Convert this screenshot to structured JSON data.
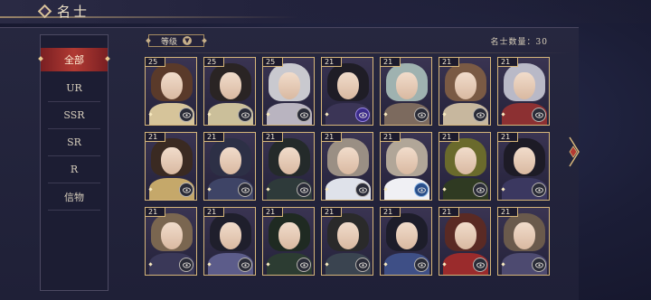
{
  "header": {
    "title": "名士"
  },
  "sidebar": {
    "items": [
      {
        "label": "全部",
        "active": true
      },
      {
        "label": "UR"
      },
      {
        "label": "SSR"
      },
      {
        "label": "SR"
      },
      {
        "label": "R"
      },
      {
        "label": "信物"
      }
    ]
  },
  "toolbar": {
    "sort_label": "等级",
    "count_text": "名士数量：30"
  },
  "cards": [
    {
      "level": "25",
      "badge": "eye-gray",
      "hair": "#5a3a2a",
      "robe": "#d6c49a"
    },
    {
      "level": "25",
      "badge": "eye-gray",
      "hair": "#2a2424",
      "robe": "#cbbf9a"
    },
    {
      "level": "25",
      "badge": "eye-gray",
      "hair": "#c9c9cf",
      "robe": "#b9b4c0"
    },
    {
      "level": "21",
      "badge": "eye-purple",
      "hair": "#1f1d26",
      "robe": "#3b3556"
    },
    {
      "level": "21",
      "badge": "eye-gray",
      "hair": "#9fb2b0",
      "robe": "#7c6a5e"
    },
    {
      "level": "21",
      "badge": "eye-gray",
      "hair": "#7a5a44",
      "robe": "#c7b79e"
    },
    {
      "level": "21",
      "badge": "eye-gray",
      "hair": "#b9b9c7",
      "robe": "#8c3032"
    },
    {
      "level": "21",
      "badge": "eye-gray",
      "hair": "#3a2a22",
      "robe": "#c5a86a"
    },
    {
      "level": "21",
      "badge": "eye-gray",
      "hair": "#2d3046",
      "robe": "#3e4466"
    },
    {
      "level": "21",
      "badge": "eye-gray",
      "hair": "#242a2a",
      "robe": "#2e3a3a"
    },
    {
      "level": "21",
      "badge": "eye-gray",
      "hair": "#9a8f84",
      "robe": "#dfe2ea"
    },
    {
      "level": "21",
      "badge": "eye-blue",
      "hair": "#b1a698",
      "robe": "#f0f0f4"
    },
    {
      "level": "21",
      "badge": "eye-gray",
      "hair": "#6a6a2c",
      "robe": "#2f3a22"
    },
    {
      "level": "21",
      "badge": "eye-gray",
      "hair": "#1d1b26",
      "robe": "#3b3860"
    },
    {
      "level": "21",
      "badge": "eye-gray",
      "hair": "#7a6650",
      "robe": "#3a3858"
    },
    {
      "level": "21",
      "badge": "eye-gray",
      "hair": "#1f1f2c",
      "robe": "#5c5c8a"
    },
    {
      "level": "21",
      "badge": "eye-gray",
      "hair": "#1f2a22",
      "robe": "#2c3c32"
    },
    {
      "level": "21",
      "badge": "eye-gray",
      "hair": "#2a2a2a",
      "robe": "#3a4450"
    },
    {
      "level": "21",
      "badge": "eye-gray",
      "hair": "#1d1d2a",
      "robe": "#3e4f86"
    },
    {
      "level": "21",
      "badge": "eye-gray",
      "hair": "#5a2a24",
      "robe": "#9a2b2c"
    },
    {
      "level": "21",
      "badge": "eye-gray",
      "hair": "#6a5a4c",
      "robe": "#4d4a70"
    }
  ],
  "colors": {
    "accent_red": "#b13a33",
    "gold_border": "#d6b67a"
  }
}
